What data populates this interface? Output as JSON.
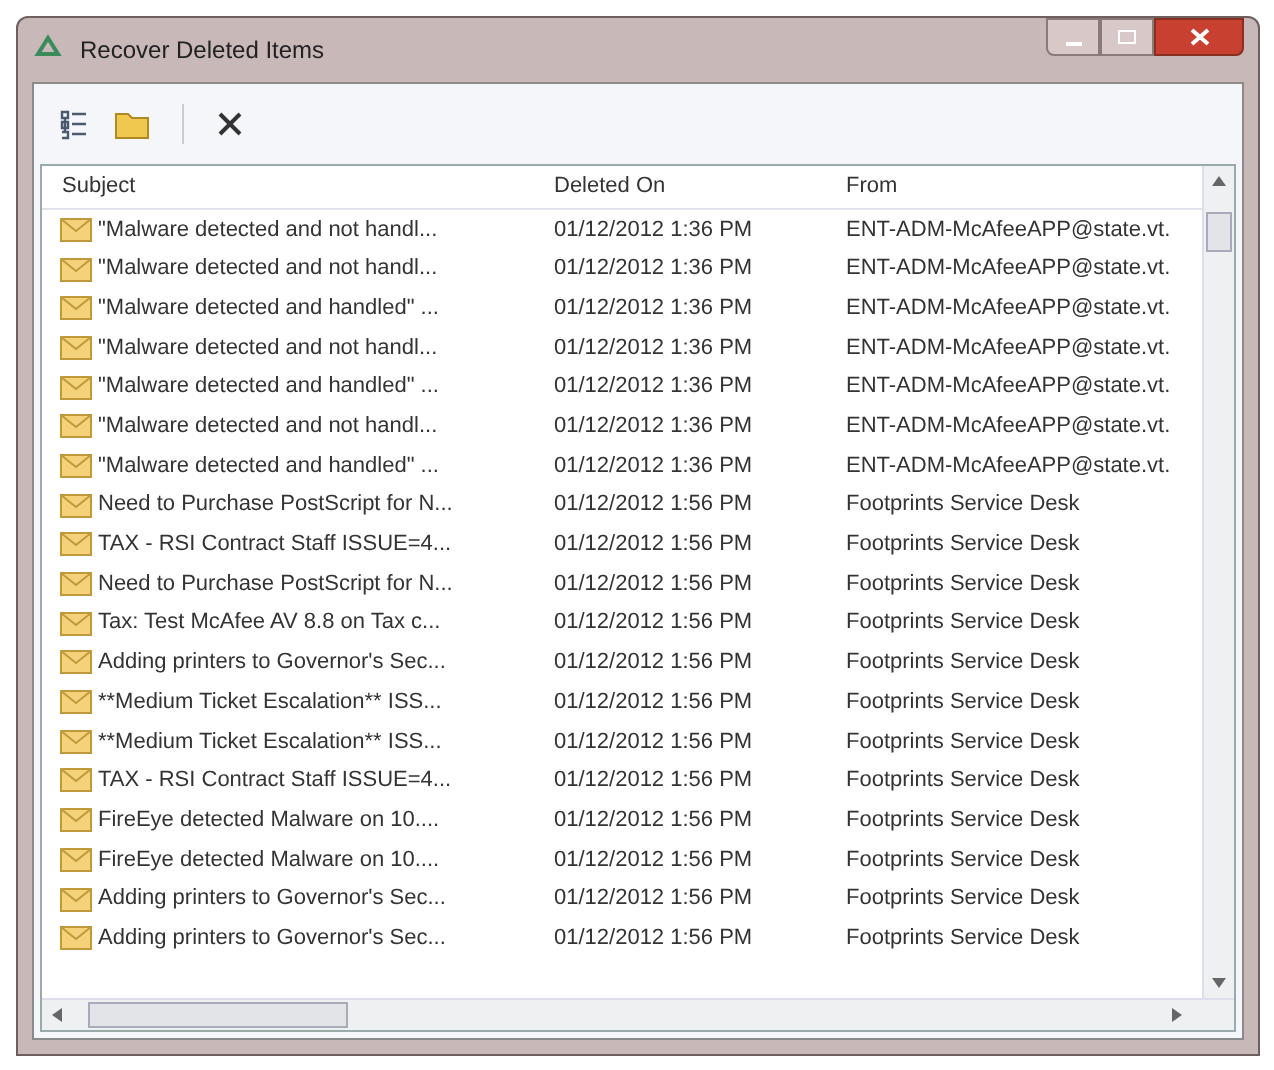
{
  "window": {
    "title": "Recover Deleted Items"
  },
  "toolbar": [
    {
      "kind": "tree"
    },
    {
      "kind": "folder"
    },
    {
      "kind": "separator"
    },
    {
      "kind": "delete"
    }
  ],
  "table": {
    "columns": [
      "Subject",
      "Deleted On",
      "From"
    ],
    "rows": [
      [
        "\"Malware detected and not handl...",
        "01/12/2012 1:36 PM",
        "ENT-ADM-McAfeeAPP@state.vt."
      ],
      [
        "\"Malware detected and not handl...",
        "01/12/2012 1:36 PM",
        "ENT-ADM-McAfeeAPP@state.vt."
      ],
      [
        "\"Malware detected and handled\" ...",
        "01/12/2012 1:36 PM",
        "ENT-ADM-McAfeeAPP@state.vt."
      ],
      [
        "\"Malware detected and not handl...",
        "01/12/2012 1:36 PM",
        "ENT-ADM-McAfeeAPP@state.vt."
      ],
      [
        "\"Malware detected and handled\" ...",
        "01/12/2012 1:36 PM",
        "ENT-ADM-McAfeeAPP@state.vt."
      ],
      [
        "\"Malware detected and not handl...",
        "01/12/2012 1:36 PM",
        "ENT-ADM-McAfeeAPP@state.vt."
      ],
      [
        "\"Malware detected and handled\" ...",
        "01/12/2012 1:36 PM",
        "ENT-ADM-McAfeeAPP@state.vt."
      ],
      [
        "Need to Purchase PostScript for N...",
        "01/12/2012 1:56 PM",
        "Footprints Service Desk"
      ],
      [
        "TAX - RSI Contract Staff ISSUE=4...",
        "01/12/2012 1:56 PM",
        "Footprints Service Desk"
      ],
      [
        "Need to Purchase PostScript for N...",
        "01/12/2012 1:56 PM",
        "Footprints Service Desk"
      ],
      [
        "Tax: Test McAfee AV 8.8 on Tax c...",
        "01/12/2012 1:56 PM",
        "Footprints Service Desk"
      ],
      [
        "Adding printers to Governor's Sec...",
        "01/12/2012 1:56 PM",
        "Footprints Service Desk"
      ],
      [
        "**Medium Ticket Escalation** ISS...",
        "01/12/2012 1:56 PM",
        "Footprints Service Desk"
      ],
      [
        "**Medium Ticket Escalation** ISS...",
        "01/12/2012 1:56 PM",
        "Footprints Service Desk"
      ],
      [
        "TAX - RSI Contract Staff ISSUE=4...",
        "01/12/2012 1:56 PM",
        "Footprints Service Desk"
      ],
      [
        "FireEye detected Malware on 10....",
        "01/12/2012 1:56 PM",
        "Footprints Service Desk"
      ],
      [
        "FireEye detected Malware on 10....",
        "01/12/2012 1:56 PM",
        "Footprints Service Desk"
      ],
      [
        "Adding printers to Governor's Sec...",
        "01/12/2012 1:56 PM",
        "Footprints Service Desk"
      ],
      [
        "Adding printers to Governor's Sec...",
        "01/12/2012 1:56 PM",
        "Footprints Service Desk"
      ]
    ]
  }
}
